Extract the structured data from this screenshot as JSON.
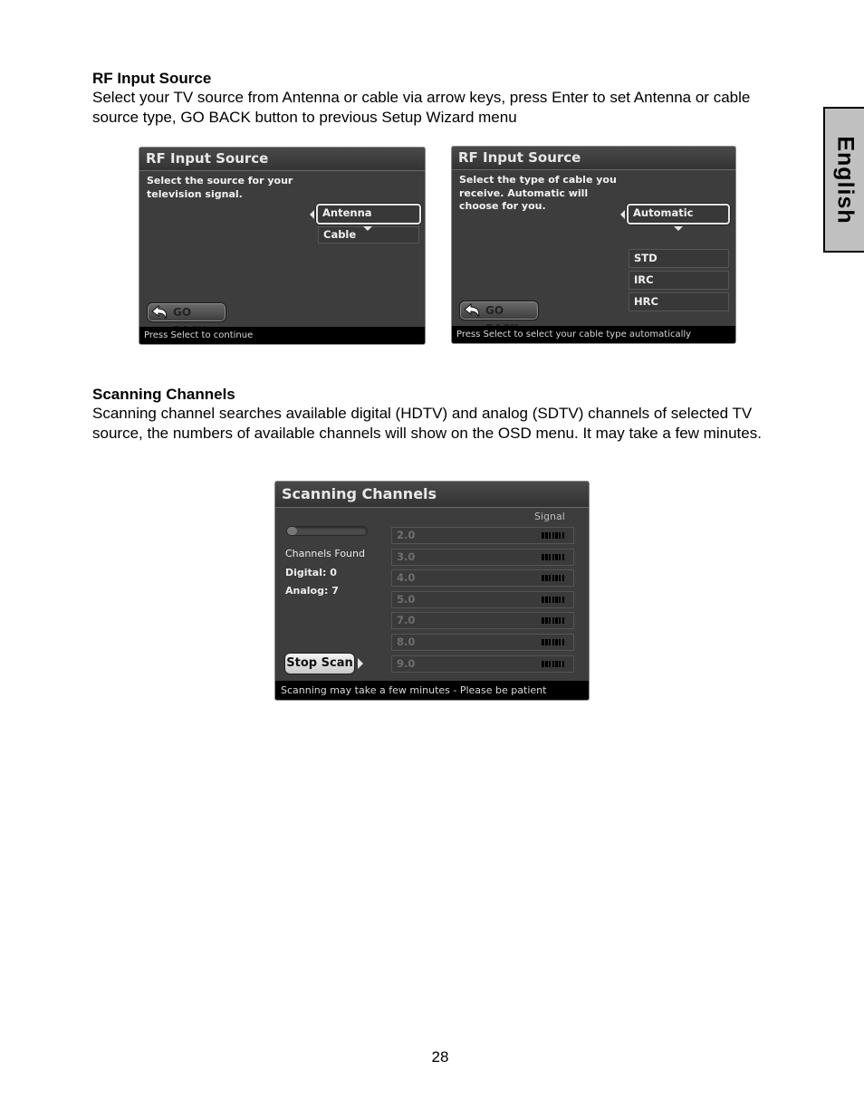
{
  "sections": [
    {
      "title": "RF Input Source",
      "body": "Select your TV source from Antenna or cable via arrow keys, press Enter to set Antenna or cable source type, GO BACK button to previous Setup Wizard menu"
    },
    {
      "title": "Scanning Channels",
      "body": "Scanning channel searches available digital (HDTV) and analog (SDTV) channels of selected TV source, the numbers of available channels will show on the OSD menu. It may take a few minutes."
    }
  ],
  "side_tab": {
    "label": "English"
  },
  "screen_source": {
    "title": "RF Input Source",
    "description": "Select the source for your\ntelevision signal.",
    "options": [
      {
        "label": "Antenna",
        "selected": true
      },
      {
        "label": "Cable",
        "selected": false
      }
    ],
    "go_back_label": "GO BACK",
    "footer": "Press Select to continue"
  },
  "screen_cable": {
    "title": "RF Input Source",
    "description": "Select the type of cable you\nreceive.  Automatic will\nchoose for you.",
    "selected_option": "Automatic",
    "options": [
      "STD",
      "IRC",
      "HRC"
    ],
    "go_back_label": "GO BACK",
    "footer": "Press Select to select your cable type automatically"
  },
  "screen_scan": {
    "title": "Scanning Channels",
    "signal_header": "Signal",
    "progress_fraction": 0.12,
    "channels_found_label": "Channels Found",
    "digital_label": "Digital: 0",
    "analog_label": "Analog: 7",
    "channels": [
      "2.0",
      "3.0",
      "4.0",
      "5.0",
      "7.0",
      "8.0",
      "9.0"
    ],
    "stop_button_label": "Stop Scan",
    "footer": "Scanning may take a few minutes - Please be patient"
  },
  "page_number": "28"
}
